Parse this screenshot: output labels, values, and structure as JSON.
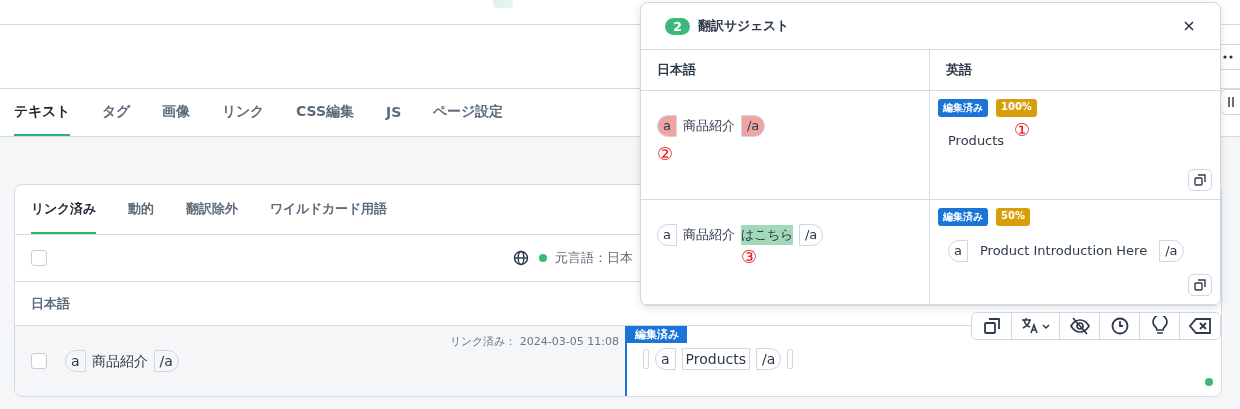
{
  "main_tabs": [
    {
      "label": "テキスト",
      "selected": true
    },
    {
      "label": "タグ",
      "selected": false
    },
    {
      "label": "画像",
      "selected": false
    },
    {
      "label": "リンク",
      "selected": false
    },
    {
      "label": "CSS編集",
      "selected": false
    },
    {
      "label": "JS",
      "selected": false
    },
    {
      "label": "ページ設定",
      "selected": false
    }
  ],
  "card": {
    "tabs": [
      {
        "label": "リンク済み",
        "selected": true
      },
      {
        "label": "動的",
        "selected": false
      },
      {
        "label": "翻訳除外",
        "selected": false
      },
      {
        "label": "ワイルドカード用語",
        "selected": false
      }
    ],
    "select_all": {
      "checked": false
    },
    "source_language": "元言語：日本",
    "columns": [
      "日本語"
    ],
    "rows": [
      {
        "checked": false,
        "linked_at": "リンク済み： 2024-03-05 11:08",
        "status": "編集済み",
        "source": [
          {
            "kind": "open",
            "text": "a"
          },
          {
            "kind": "text",
            "text": "商品紹介"
          },
          {
            "kind": "close",
            "text": "/a"
          }
        ],
        "target": [
          {
            "kind": "empty"
          },
          {
            "kind": "open",
            "text": "a"
          },
          {
            "kind": "boxed",
            "text": "Products"
          },
          {
            "kind": "close",
            "text": "/a"
          },
          {
            "kind": "empty"
          }
        ]
      }
    ]
  },
  "suggest_popup": {
    "count": "2",
    "title": "翻訳サジェスト",
    "columns": [
      "日本語",
      "英語"
    ],
    "rows": [
      {
        "source_note": "②",
        "target_note": "①",
        "badges": [
          {
            "text": "編集済み",
            "kind": "edited"
          },
          {
            "text": "100%",
            "kind": "match"
          }
        ],
        "source": [
          {
            "kind": "open",
            "text": "a",
            "removed": true,
            "added": false
          },
          {
            "kind": "text",
            "text": "商品紹介",
            "removed": false,
            "added": false
          },
          {
            "kind": "close",
            "text": "/a",
            "removed": true,
            "added": false
          }
        ],
        "target": [
          {
            "kind": "text",
            "text": "Products",
            "removed": false,
            "added": false
          }
        ]
      },
      {
        "source_note": "③",
        "badges": [
          {
            "text": "編集済み",
            "kind": "edited"
          },
          {
            "text": "50%",
            "kind": "match"
          }
        ],
        "source": [
          {
            "kind": "open",
            "text": "a",
            "removed": false,
            "added": false
          },
          {
            "kind": "text",
            "text": "商品紹介",
            "removed": false,
            "added": false
          },
          {
            "kind": "text",
            "text": "はこちら",
            "removed": false,
            "added": true
          },
          {
            "kind": "close",
            "text": "/a",
            "removed": false,
            "added": false
          }
        ],
        "target": [
          {
            "kind": "open",
            "text": "a",
            "removed": false,
            "added": false
          },
          {
            "kind": "text",
            "text": "Product Introduction Here",
            "removed": false,
            "added": false
          },
          {
            "kind": "close",
            "text": "/a",
            "removed": false,
            "added": false
          }
        ]
      }
    ]
  }
}
